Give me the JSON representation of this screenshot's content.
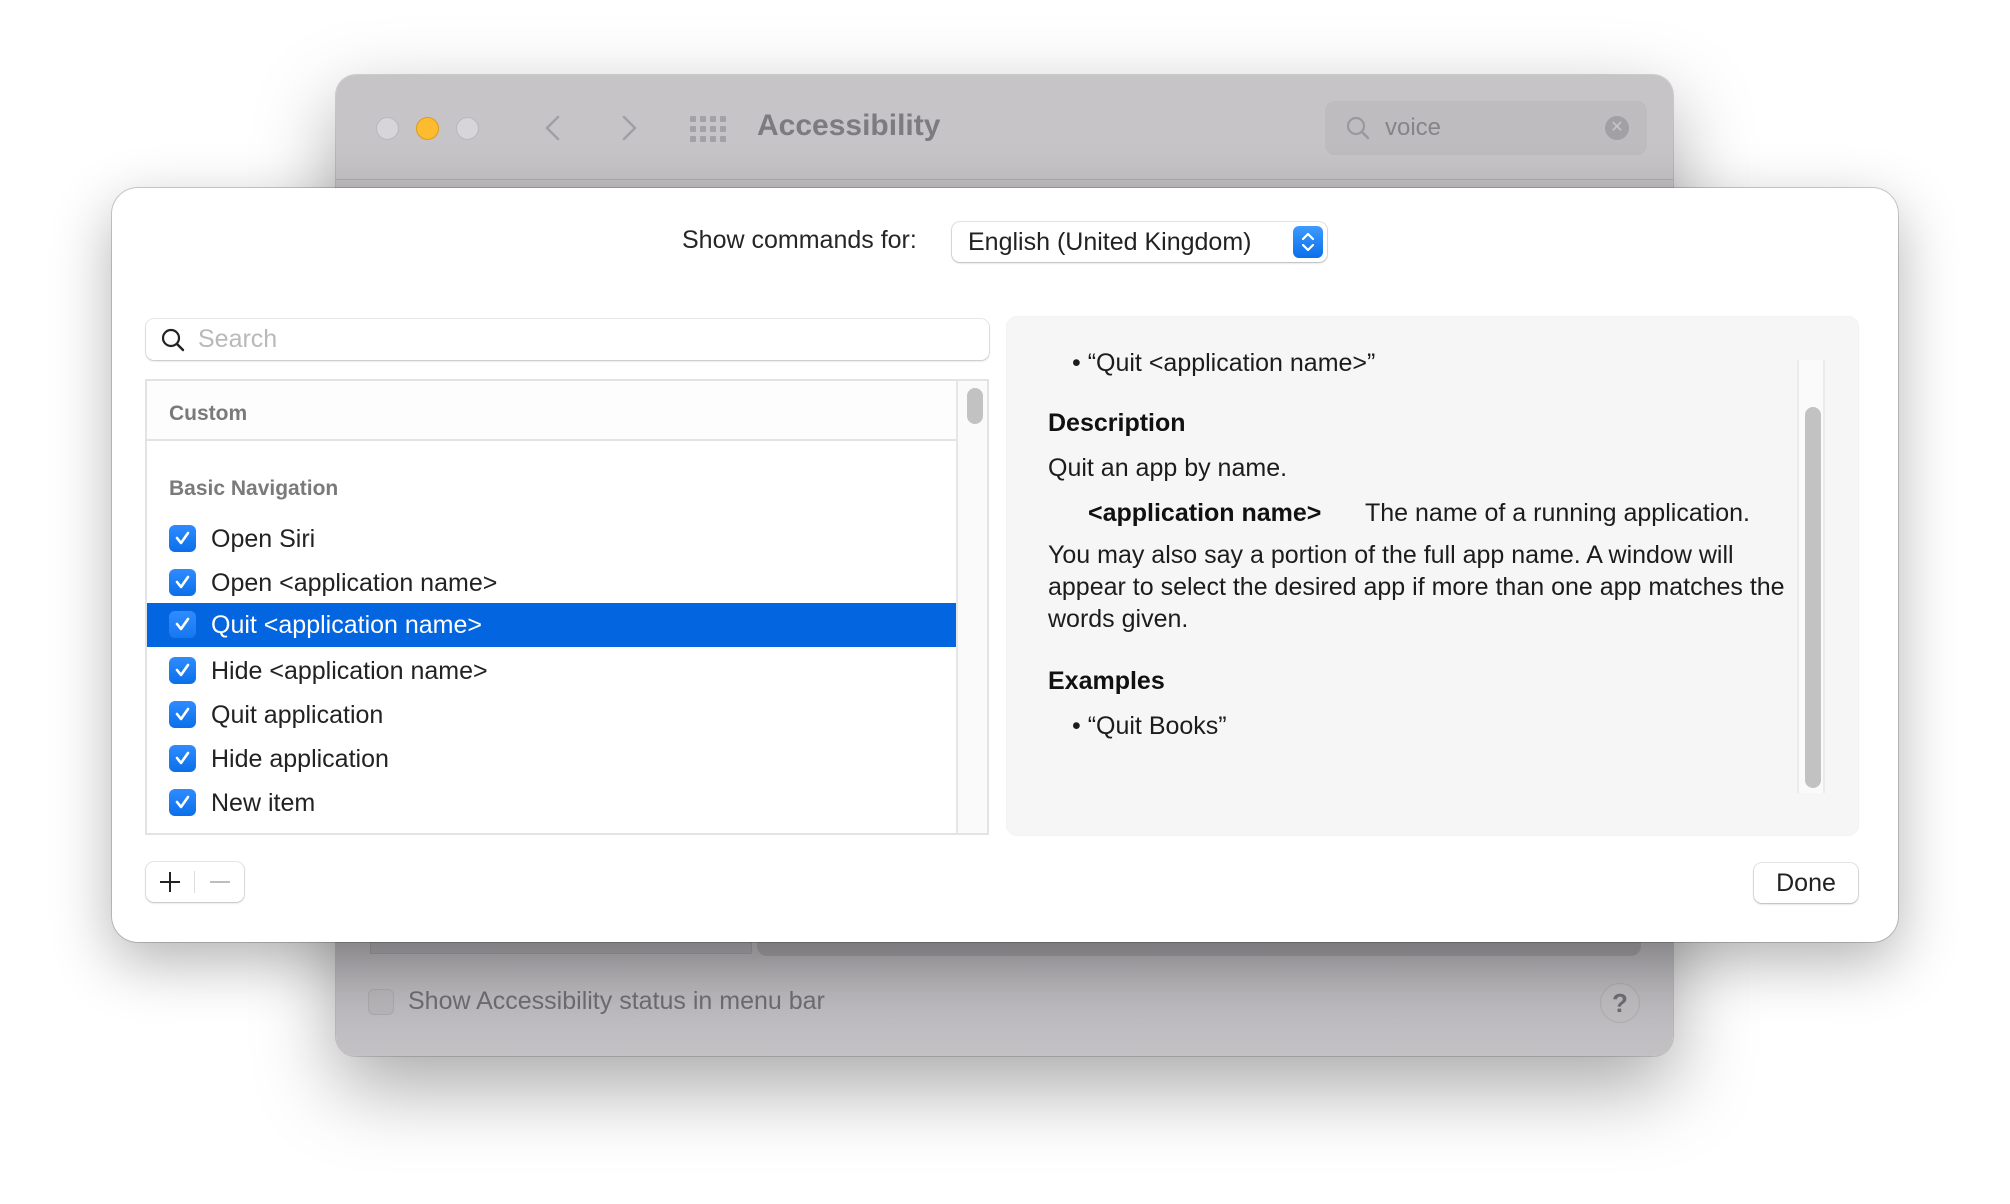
{
  "window": {
    "title": "Accessibility",
    "traffic_lights": [
      "close",
      "minimize",
      "zoom"
    ],
    "nav": {
      "back_icon": "chevron-left-icon",
      "forward_icon": "chevron-right-icon",
      "grid_icon": "show-all-grid-icon"
    },
    "search": {
      "value": "voice",
      "icon": "search-icon",
      "clear_icon": "clear-icon"
    },
    "footer": {
      "status_checkbox_label": "Show Accessibility status in menu bar",
      "status_checkbox_checked": false,
      "help_label": "?"
    }
  },
  "dialog": {
    "show_commands_label": "Show commands for:",
    "language_selected": "English (United Kingdom)",
    "search": {
      "placeholder": "Search",
      "value": ""
    },
    "list": {
      "sections": [
        {
          "title": "Custom",
          "items": []
        },
        {
          "title": "Basic Navigation",
          "items": [
            {
              "label": "Open Siri",
              "checked": true,
              "selected": false
            },
            {
              "label": "Open <application name>",
              "checked": true,
              "selected": false
            },
            {
              "label": "Quit <application name>",
              "checked": true,
              "selected": true
            },
            {
              "label": "Hide <application name>",
              "checked": true,
              "selected": false
            },
            {
              "label": "Quit application",
              "checked": true,
              "selected": false
            },
            {
              "label": "Hide application",
              "checked": true,
              "selected": false
            },
            {
              "label": "New item",
              "checked": true,
              "selected": false
            }
          ]
        }
      ]
    },
    "detail": {
      "phrase_bullet": "• “Quit <application name>”",
      "description_heading": "Description",
      "description_text": "Quit an app by name.",
      "param_name": "<application name>",
      "param_desc": "The name of a running application.",
      "paragraph": "You may also say a portion of the full app name. A window will appear to select the desired app if more than one app matches the words given.",
      "examples_heading": "Examples",
      "examples": [
        "• “Quit Books”"
      ]
    },
    "buttons": {
      "add": "+",
      "remove": "−",
      "done": "Done"
    },
    "colors": {
      "accent": "#0366e0",
      "checkbox": "#0a6fe9"
    }
  }
}
